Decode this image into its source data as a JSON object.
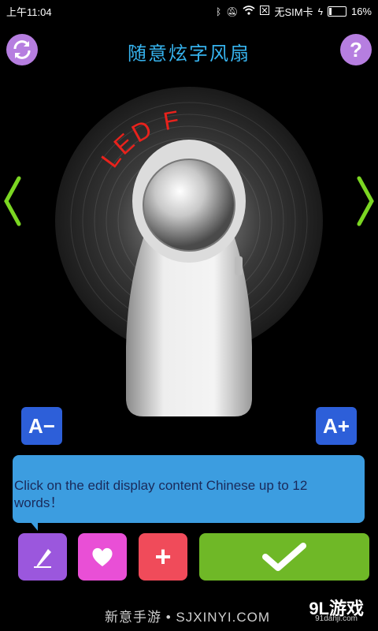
{
  "status_bar": {
    "time": "上午11:04",
    "carrier": "无SIM卡",
    "battery_text": "16%",
    "battery_level": 0.16
  },
  "header": {
    "title": "随意炫字风扇",
    "help_label": "?"
  },
  "fan": {
    "display_text": "LED F"
  },
  "font_size": {
    "decrease_label": "A−",
    "increase_label": "A+"
  },
  "message": {
    "text": "Click on the edit display content Chinese up to 12 words！"
  },
  "controls": {
    "plus_label": "+"
  },
  "footer": {
    "brand": "新意手游 • SJXINYI.COM",
    "logo": "9L游戏",
    "logo_sub": "91danji.com"
  },
  "colors": {
    "title": "#36b3ee",
    "top_button": "#b67ee0",
    "font_button": "#2d5fd9",
    "bubble": "#3c9de0",
    "edit_button": "#9b57dd",
    "favorite_button": "#e94fd6",
    "add_button": "#f04b5a",
    "confirm_button": "#6fb827",
    "arrow": "#7bd622"
  }
}
